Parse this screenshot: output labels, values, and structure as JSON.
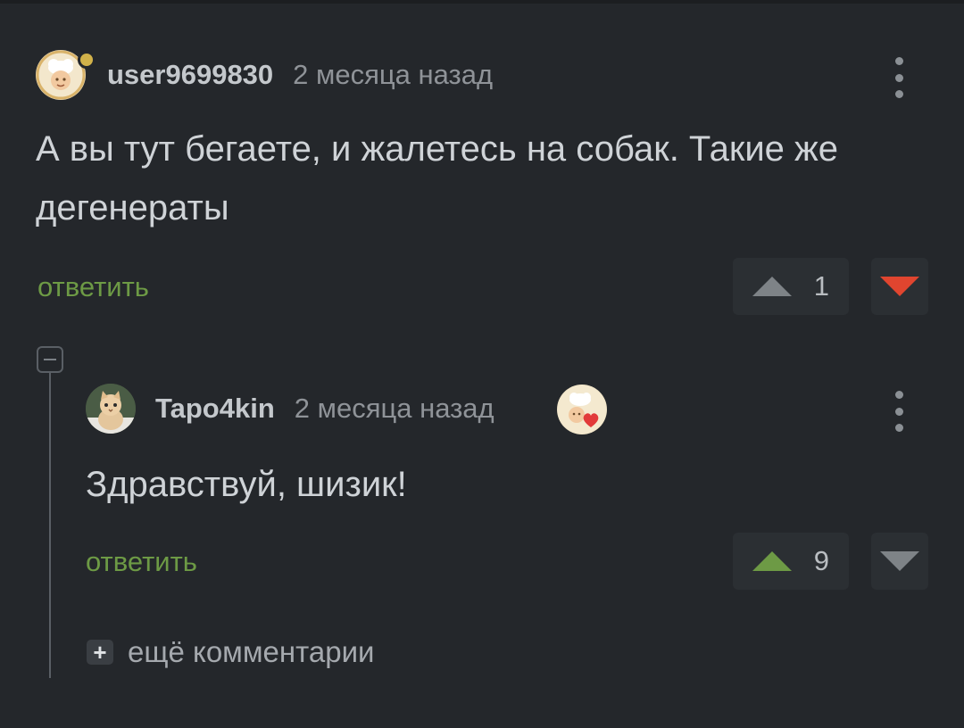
{
  "colors": {
    "background": "#24272b",
    "reply_green": "#6d9a45",
    "downvote_red": "#e0452f",
    "upvote_green": "#6d9a45",
    "vote_neutral": "#7e8387"
  },
  "comments": [
    {
      "username": "user9699830",
      "timestamp": "2 месяца назад",
      "text": "А вы тут бегаете, и жалетесь на собак. Такие же дегенераты",
      "reply_label": "ответить",
      "rating": "1",
      "vote_state": "downvoted",
      "avatar_icon": "chef-avatar-icon",
      "online_indicator": true
    },
    {
      "username": "Tapo4kin",
      "timestamp": "2 месяца назад",
      "text": "Здравствуй, шизик!",
      "reply_label": "ответить",
      "rating": "9",
      "vote_state": "upvoted",
      "avatar_icon": "cat-avatar-icon",
      "badge_icon": "chef-heart-badge-icon"
    }
  ],
  "thread": {
    "more_comments_label": "ещё комментарии",
    "more_comments_symbol": "+"
  }
}
